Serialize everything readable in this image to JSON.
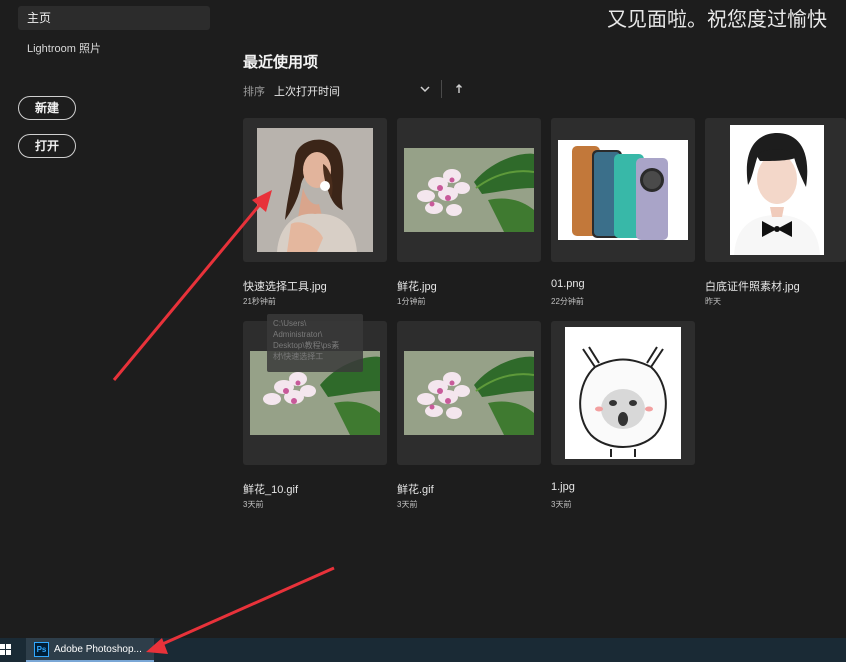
{
  "header": {
    "greeting": "又见面啦。祝您度过愉快"
  },
  "sidebar": {
    "items": [
      {
        "label": "主页",
        "selected": true
      },
      {
        "label": "Lightroom 照片"
      }
    ],
    "new_label": "新建",
    "open_label": "打开"
  },
  "main": {
    "title": "最近使用项",
    "sort": {
      "label": "排序",
      "value": "上次打开时间",
      "chevron_icon": "chevron-down-icon",
      "direction_icon": "arrow-up-icon"
    },
    "files": [
      {
        "name": "快速选择工具.jpg",
        "time": "21秒钟前",
        "thumb": "portrait-woman"
      },
      {
        "name": "鲜花.jpg",
        "time": "1分钟前",
        "thumb": "flower"
      },
      {
        "name": "01.png",
        "time": "22分钟前",
        "thumb": "phones"
      },
      {
        "name": "白底证件照素材.jpg",
        "time": "昨天",
        "thumb": "id-photo"
      },
      {
        "name": "鲜花_10.gif",
        "time": "3天前",
        "thumb": "flower"
      },
      {
        "name": "鲜花.gif",
        "time": "3天前",
        "thumb": "flower"
      },
      {
        "name": "1.jpg",
        "time": "3天前",
        "thumb": "meme-face"
      }
    ],
    "tooltip": [
      "C:\\Users\\",
      "Administrator\\",
      "Desktop\\教程\\ps素",
      "材\\快速选择工"
    ]
  },
  "taskbar": {
    "app_label": "Adobe Photoshop...",
    "app_icon": "Ps"
  },
  "colors": {
    "background": "#1d1d1d",
    "card": "#2d2d2d",
    "annotation": "#e8323a",
    "taskbar": "#1a2a35"
  }
}
